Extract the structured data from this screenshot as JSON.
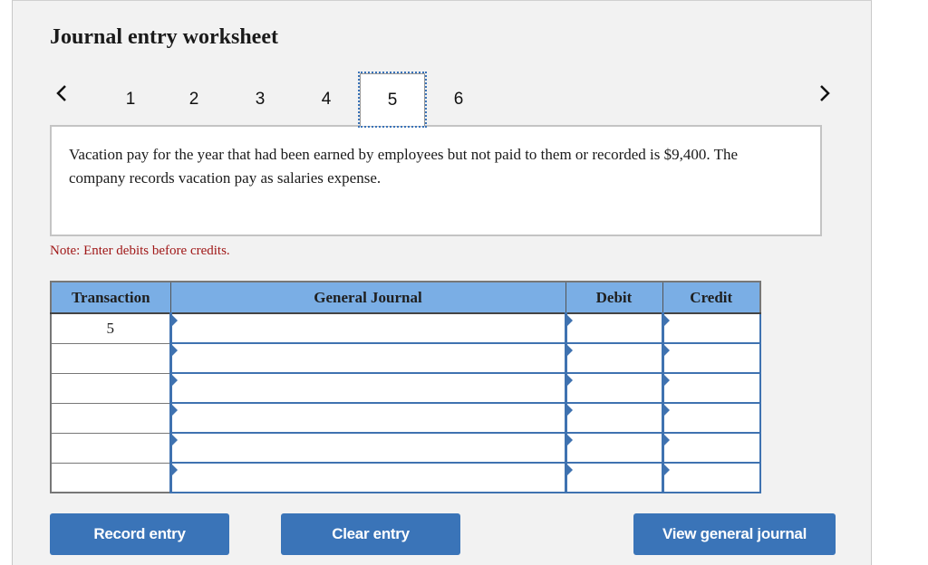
{
  "worksheet": {
    "title": "Journal entry worksheet",
    "nav": {
      "prev_icon": "chevron-left-icon",
      "next_icon": "chevron-right-icon",
      "steps": [
        "1",
        "2",
        "3",
        "4",
        "5",
        "6"
      ],
      "active_step": "5"
    },
    "description": "Vacation pay for the year that had been earned by employees but not paid to them or recorded is $9,400. The company records vacation pay as salaries expense.",
    "note": "Note: Enter debits before credits.",
    "table": {
      "headers": {
        "transaction": "Transaction",
        "general_journal": "General Journal",
        "debit": "Debit",
        "credit": "Credit"
      },
      "rows": [
        {
          "transaction": "5",
          "account": "",
          "debit": "",
          "credit": ""
        },
        {
          "transaction": "",
          "account": "",
          "debit": "",
          "credit": ""
        },
        {
          "transaction": "",
          "account": "",
          "debit": "",
          "credit": ""
        },
        {
          "transaction": "",
          "account": "",
          "debit": "",
          "credit": ""
        },
        {
          "transaction": "",
          "account": "",
          "debit": "",
          "credit": ""
        },
        {
          "transaction": "",
          "account": "",
          "debit": "",
          "credit": ""
        }
      ]
    },
    "buttons": {
      "record": "Record entry",
      "clear": "Clear entry",
      "view": "View general journal"
    }
  },
  "colors": {
    "header_bg": "#7aaee5",
    "button_bg": "#3a74b8",
    "note_text": "#a01818",
    "cell_border": "#3f72b0",
    "panel_bg": "#f2f2f2"
  }
}
